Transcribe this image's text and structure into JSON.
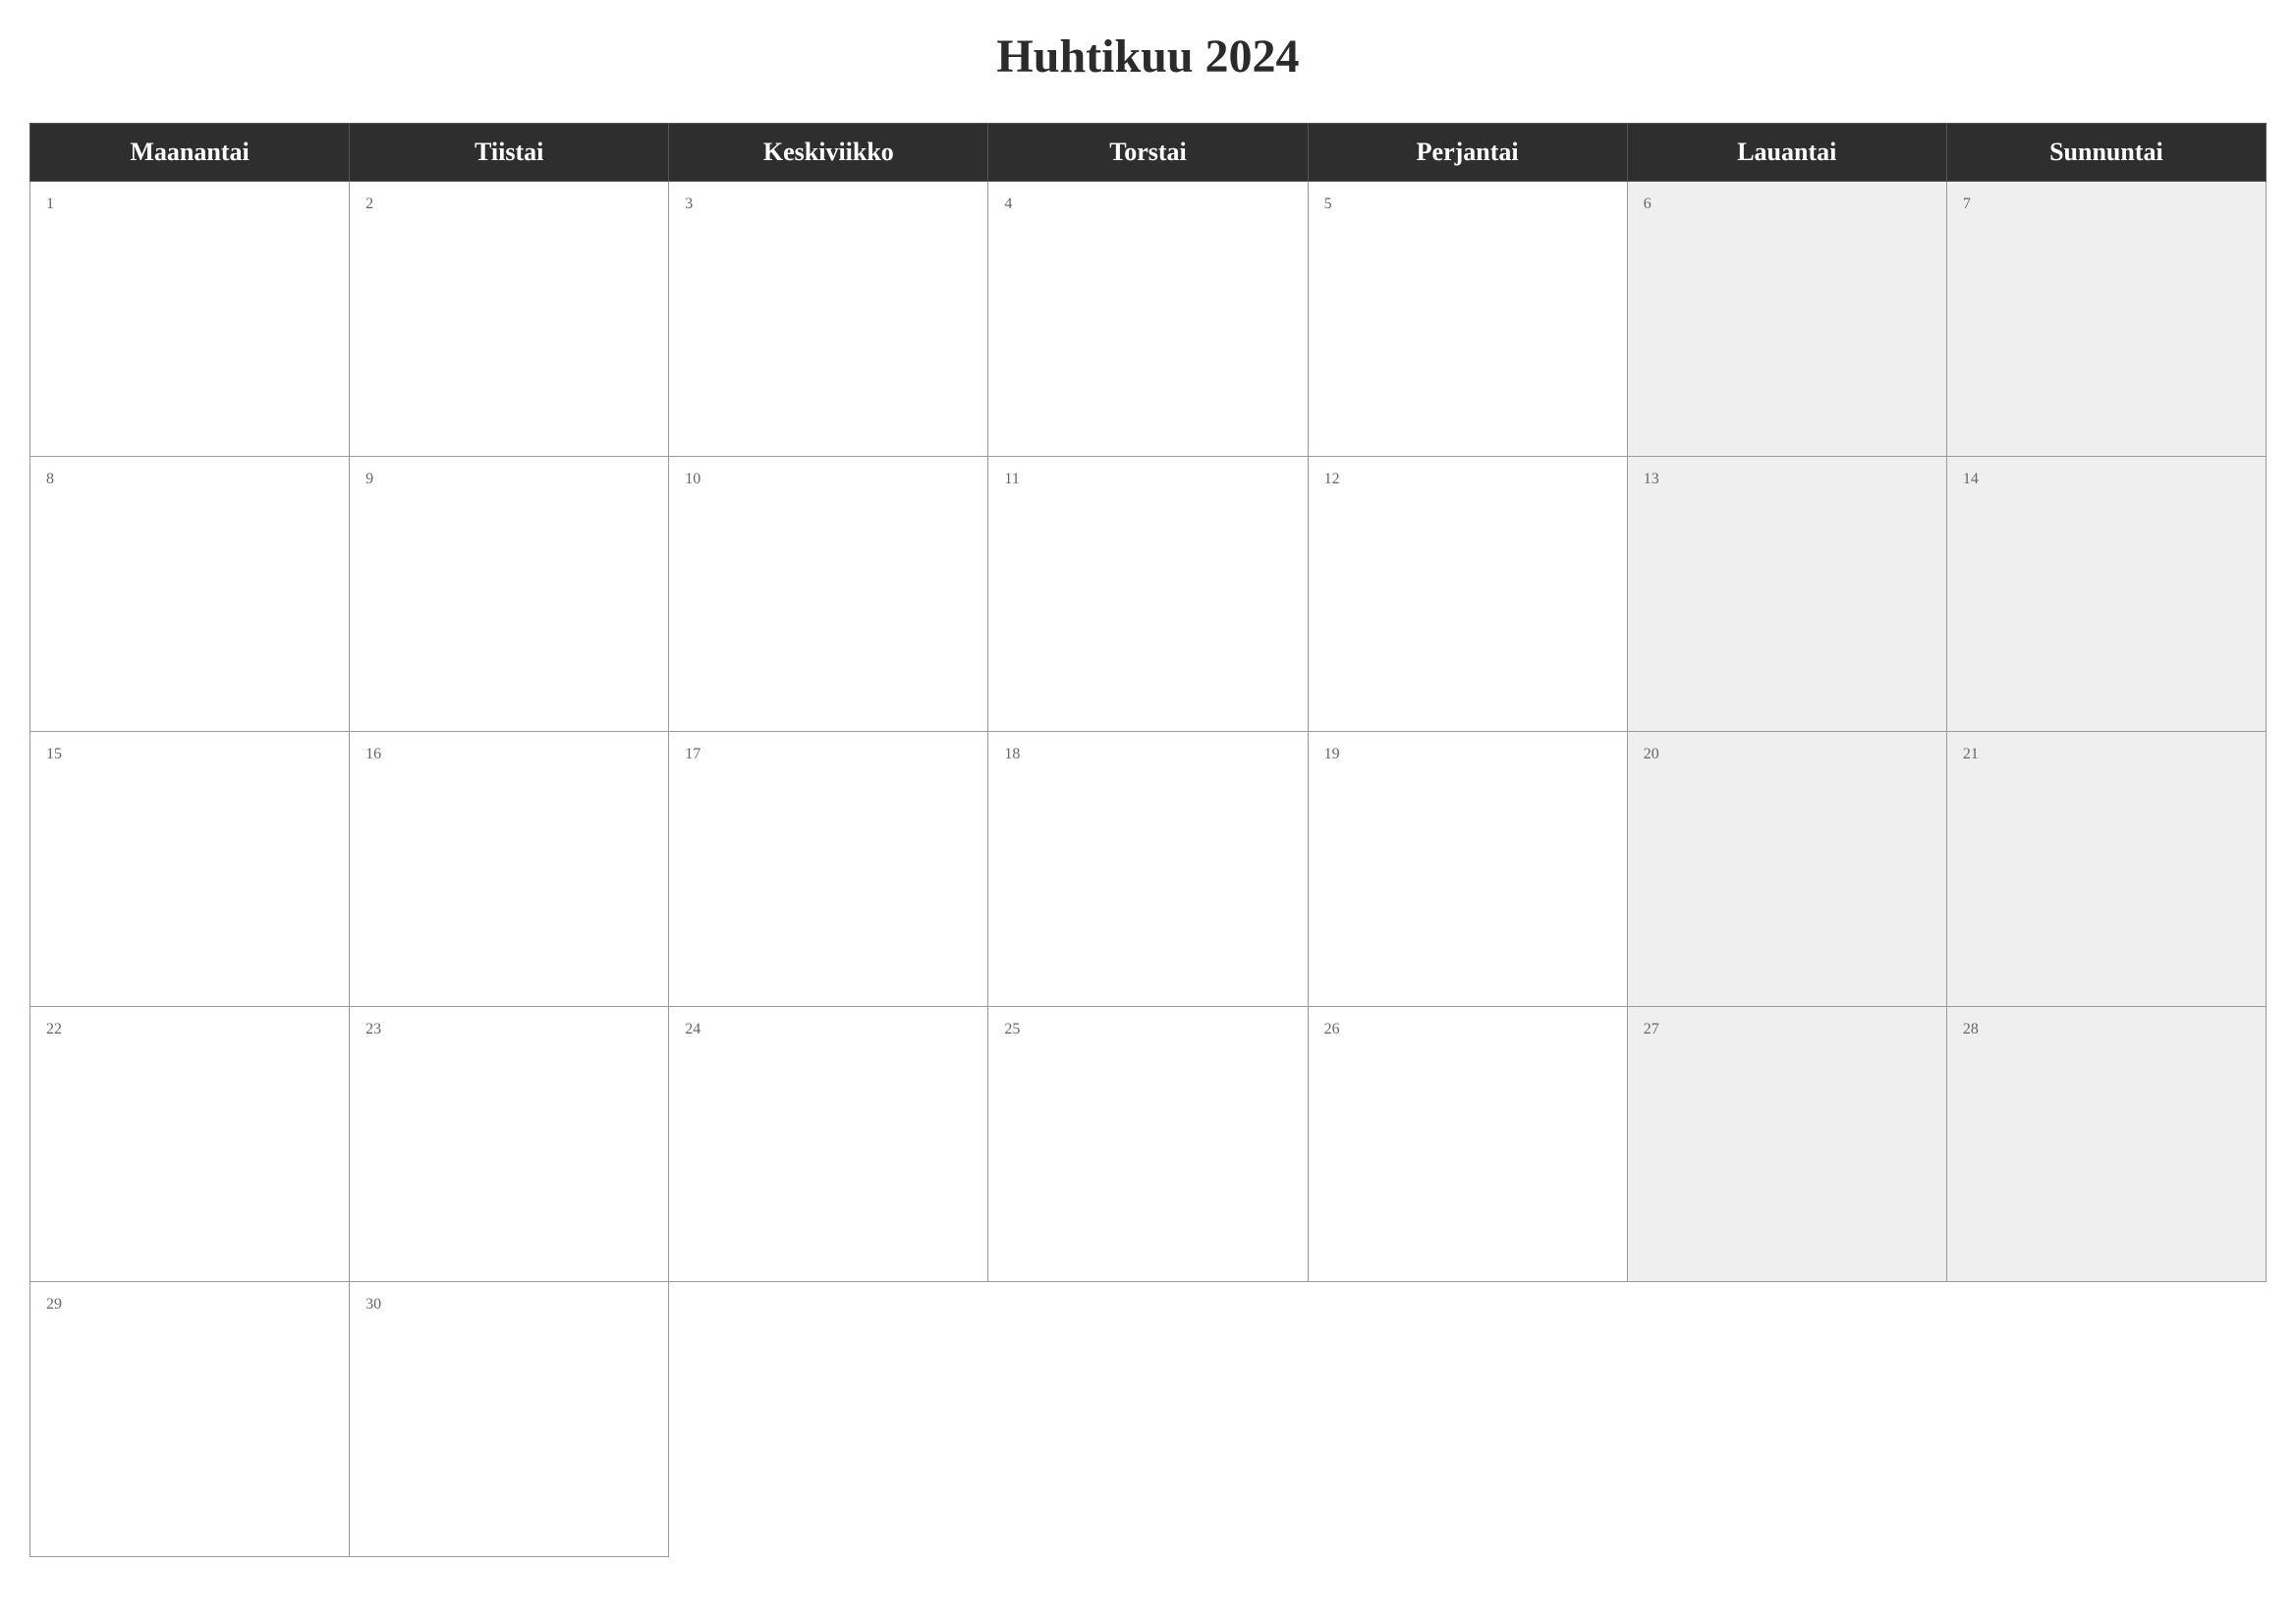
{
  "title": "Huhtikuu 2024",
  "weekdays": [
    "Maanantai",
    "Tiistai",
    "Keskiviikko",
    "Torstai",
    "Perjantai",
    "Lauantai",
    "Sunnuntai"
  ],
  "weeks": [
    [
      {
        "day": "1",
        "weekend": false
      },
      {
        "day": "2",
        "weekend": false
      },
      {
        "day": "3",
        "weekend": false
      },
      {
        "day": "4",
        "weekend": false
      },
      {
        "day": "5",
        "weekend": false
      },
      {
        "day": "6",
        "weekend": true
      },
      {
        "day": "7",
        "weekend": true
      }
    ],
    [
      {
        "day": "8",
        "weekend": false
      },
      {
        "day": "9",
        "weekend": false
      },
      {
        "day": "10",
        "weekend": false
      },
      {
        "day": "11",
        "weekend": false
      },
      {
        "day": "12",
        "weekend": false
      },
      {
        "day": "13",
        "weekend": true
      },
      {
        "day": "14",
        "weekend": true
      }
    ],
    [
      {
        "day": "15",
        "weekend": false
      },
      {
        "day": "16",
        "weekend": false
      },
      {
        "day": "17",
        "weekend": false
      },
      {
        "day": "18",
        "weekend": false
      },
      {
        "day": "19",
        "weekend": false
      },
      {
        "day": "20",
        "weekend": true
      },
      {
        "day": "21",
        "weekend": true
      }
    ],
    [
      {
        "day": "22",
        "weekend": false
      },
      {
        "day": "23",
        "weekend": false
      },
      {
        "day": "24",
        "weekend": false
      },
      {
        "day": "25",
        "weekend": false
      },
      {
        "day": "26",
        "weekend": false
      },
      {
        "day": "27",
        "weekend": true
      },
      {
        "day": "28",
        "weekend": true
      }
    ],
    [
      {
        "day": "29",
        "weekend": false
      },
      {
        "day": "30",
        "weekend": false
      },
      {
        "day": "",
        "weekend": false,
        "empty": true
      },
      {
        "day": "",
        "weekend": false,
        "empty": true
      },
      {
        "day": "",
        "weekend": false,
        "empty": true
      },
      {
        "day": "",
        "weekend": false,
        "empty": true
      },
      {
        "day": "",
        "weekend": false,
        "empty": true
      }
    ]
  ]
}
